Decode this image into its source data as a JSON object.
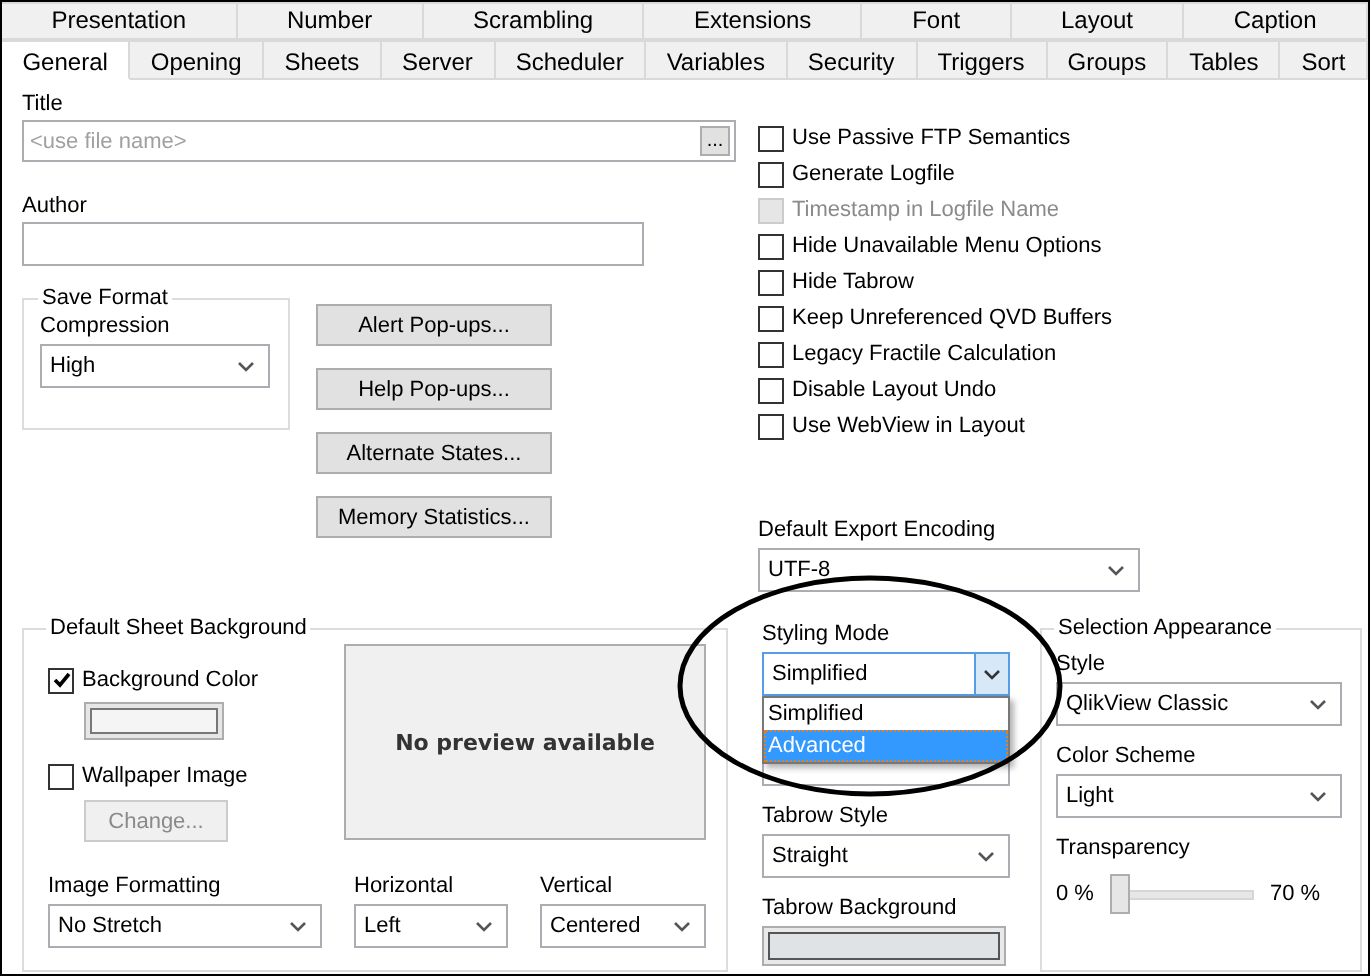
{
  "tabs": {
    "rows": [
      {
        "tabs": [
          {
            "label": "Presentation",
            "selected": false
          },
          {
            "label": "Number",
            "selected": false
          },
          {
            "label": "Scrambling",
            "selected": false
          },
          {
            "label": "Extensions",
            "selected": false
          },
          {
            "label": "Font",
            "selected": false
          },
          {
            "label": "Layout",
            "selected": false
          },
          {
            "label": "Caption",
            "selected": false
          }
        ]
      },
      {
        "tabs": [
          {
            "label": "General",
            "selected": true
          },
          {
            "label": "Opening",
            "selected": false
          },
          {
            "label": "Sheets",
            "selected": false
          },
          {
            "label": "Server",
            "selected": false
          },
          {
            "label": "Scheduler",
            "selected": false
          },
          {
            "label": "Variables",
            "selected": false
          },
          {
            "label": "Security",
            "selected": false
          },
          {
            "label": "Triggers",
            "selected": false
          },
          {
            "label": "Groups",
            "selected": false
          },
          {
            "label": "Tables",
            "selected": false
          },
          {
            "label": "Sort",
            "selected": false
          }
        ]
      }
    ]
  },
  "title_field": {
    "label": "Title",
    "placeholder": "<use file name>",
    "browse": "..."
  },
  "author_field": {
    "label": "Author"
  },
  "save_format": {
    "title": "Save Format",
    "compression": {
      "label": "Compression",
      "value": "High"
    }
  },
  "buttons": [
    "Alert Pop-ups...",
    "Help Pop-ups...",
    "Alternate States...",
    "Memory Statistics..."
  ],
  "options": [
    {
      "label": "Use Passive FTP Semantics",
      "checked": false,
      "disabled": false
    },
    {
      "label": "Generate Logfile",
      "checked": false,
      "disabled": false
    },
    {
      "label": "Timestamp in Logfile Name",
      "checked": false,
      "disabled": true
    },
    {
      "label": "Hide Unavailable Menu Options",
      "checked": false,
      "disabled": false
    },
    {
      "label": "Hide Tabrow",
      "checked": false,
      "disabled": false
    },
    {
      "label": "Keep Unreferenced QVD Buffers",
      "checked": false,
      "disabled": false
    },
    {
      "label": "Legacy Fractile Calculation",
      "checked": false,
      "disabled": false
    },
    {
      "label": "Disable Layout Undo",
      "checked": false,
      "disabled": false
    },
    {
      "label": "Use WebView in Layout",
      "checked": false,
      "disabled": false
    }
  ],
  "export_encoding": {
    "label": "Default Export Encoding",
    "value": "UTF-8"
  },
  "sheet_background": {
    "title": "Default Sheet Background",
    "background_color": {
      "label": "Background Color",
      "checked": true
    },
    "wallpaper_image": {
      "label": "Wallpaper Image",
      "checked": false
    },
    "change_button": {
      "label": "Change...",
      "disabled": true
    },
    "preview": "No preview available",
    "image_formatting": {
      "label": "Image Formatting",
      "value": "No Stretch"
    },
    "horizontal": {
      "label": "Horizontal",
      "value": "Left"
    },
    "vertical": {
      "label": "Vertical",
      "value": "Centered"
    }
  },
  "styling_mode": {
    "label": "Styling Mode",
    "value": "Simplified",
    "expanded": true,
    "options": [
      {
        "label": "Simplified",
        "highlighted": false
      },
      {
        "label": "Advanced",
        "highlighted": true
      }
    ]
  },
  "tabrow_style": {
    "label": "Tabrow Style",
    "value": "Straight"
  },
  "tabrow_background": {
    "label": "Tabrow Background"
  },
  "selection_appearance": {
    "title": "Selection Appearance",
    "style": {
      "label": "Style",
      "value": "QlikView Classic"
    },
    "color_scheme": {
      "label": "Color Scheme",
      "value": "Light"
    },
    "transparency": {
      "label": "Transparency",
      "min": "0 %",
      "max": "70 %",
      "level": 0
    }
  }
}
